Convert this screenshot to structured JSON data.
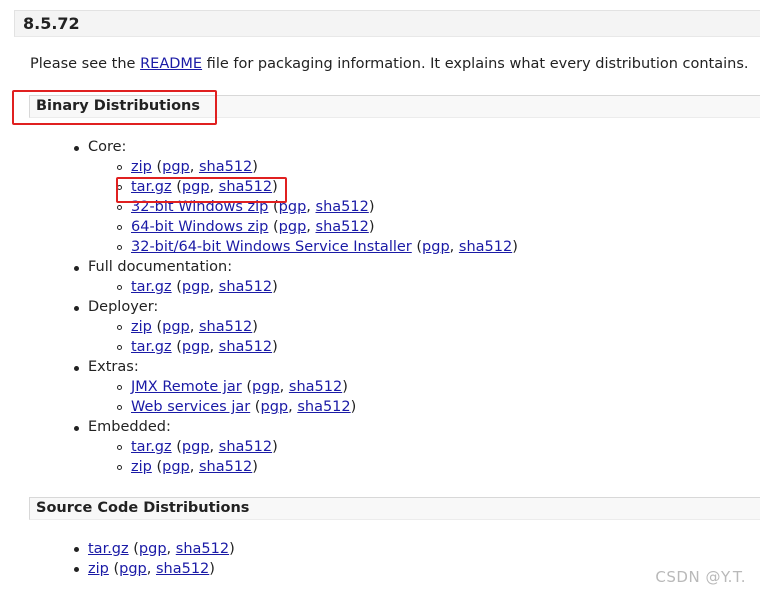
{
  "version_title": "8.5.72",
  "intro": {
    "prefix": "Please see the ",
    "link": "README",
    "suffix": " file for packaging information. It explains what every distribution contains."
  },
  "binary": {
    "heading": "Binary Distributions",
    "core": {
      "label": "Core:",
      "items": [
        {
          "name": "zip",
          "pgp": "pgp",
          "sha": "sha512"
        },
        {
          "name": "tar.gz",
          "pgp": "pgp",
          "sha": "sha512"
        },
        {
          "name": "32-bit Windows zip",
          "pgp": "pgp",
          "sha": "sha512"
        },
        {
          "name": "64-bit Windows zip",
          "pgp": "pgp",
          "sha": "sha512"
        },
        {
          "name": "32-bit/64-bit Windows Service Installer",
          "pgp": "pgp",
          "sha": "sha512"
        }
      ]
    },
    "fulldoc": {
      "label": "Full documentation:",
      "items": [
        {
          "name": "tar.gz",
          "pgp": "pgp",
          "sha": "sha512"
        }
      ]
    },
    "deployer": {
      "label": "Deployer:",
      "items": [
        {
          "name": "zip",
          "pgp": "pgp",
          "sha": "sha512"
        },
        {
          "name": "tar.gz",
          "pgp": "pgp",
          "sha": "sha512"
        }
      ]
    },
    "extras": {
      "label": "Extras:",
      "items": [
        {
          "name": "JMX Remote jar",
          "pgp": "pgp",
          "sha": "sha512"
        },
        {
          "name": "Web services jar",
          "pgp": "pgp",
          "sha": "sha512"
        }
      ]
    },
    "embedded": {
      "label": "Embedded:",
      "items": [
        {
          "name": "tar.gz",
          "pgp": "pgp",
          "sha": "sha512"
        },
        {
          "name": "zip",
          "pgp": "pgp",
          "sha": "sha512"
        }
      ]
    }
  },
  "source": {
    "heading": "Source Code Distributions",
    "items": [
      {
        "name": "tar.gz",
        "pgp": "pgp",
        "sha": "sha512"
      },
      {
        "name": "zip",
        "pgp": "pgp",
        "sha": "sha512"
      }
    ]
  },
  "watermark": "CSDN @Y.T.",
  "colors": {
    "link": "#1a1aa6",
    "highlight": "#e02020"
  }
}
